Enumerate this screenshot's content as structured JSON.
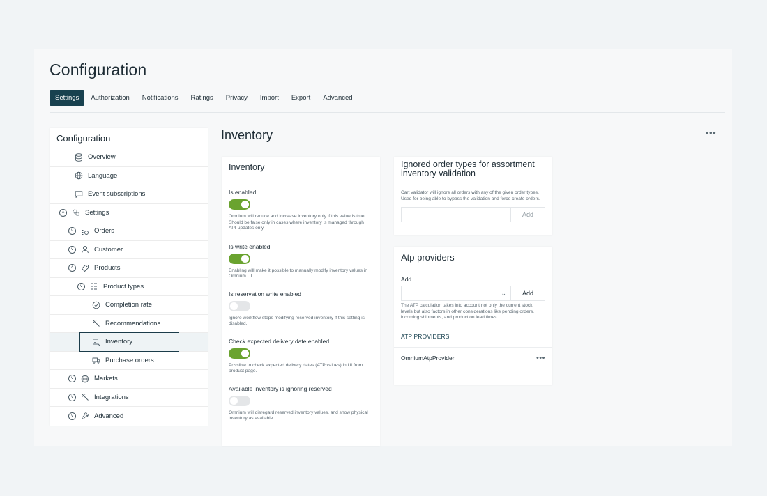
{
  "page": {
    "title": "Configuration"
  },
  "tabs": [
    "Settings",
    "Authorization",
    "Notifications",
    "Ratings",
    "Privacy",
    "Import",
    "Export",
    "Advanced"
  ],
  "sidebar": {
    "title": "Configuration",
    "items": [
      {
        "label": "Overview",
        "icon": "database-icon"
      },
      {
        "label": "Language",
        "icon": "globe-icon"
      },
      {
        "label": "Event subscriptions",
        "icon": "message-icon"
      },
      {
        "label": "Settings",
        "icon": "gears-icon",
        "chevron": "up"
      },
      {
        "label": "Orders",
        "icon": "orders-icon",
        "chevron": "down"
      },
      {
        "label": "Customer",
        "icon": "user-icon",
        "chevron": "down"
      },
      {
        "label": "Products",
        "icon": "tag-icon",
        "chevron": "up"
      },
      {
        "label": "Product types",
        "icon": "list-icon",
        "chevron": "down"
      },
      {
        "label": "Completion rate",
        "icon": "check-circle-icon"
      },
      {
        "label": "Recommendations",
        "icon": "wand-icon"
      },
      {
        "label": "Inventory",
        "icon": "inventory-icon",
        "selected": true
      },
      {
        "label": "Purchase orders",
        "icon": "truck-icon"
      },
      {
        "label": "Markets",
        "icon": "globe-icon",
        "chevron": "down"
      },
      {
        "label": "Integrations",
        "icon": "plug-icon",
        "chevron": "down"
      },
      {
        "label": "Advanced",
        "icon": "wrench-icon",
        "chevron": "down"
      }
    ]
  },
  "content": {
    "title": "Inventory",
    "more": "•••"
  },
  "inventory_card": {
    "title": "Inventory",
    "settings": [
      {
        "label": "Is enabled",
        "on": true,
        "help": "Omnium will reduce and increase inventory only if this value is true. Should be false only in cases where inventory is managed through API-updates only."
      },
      {
        "label": "Is write enabled",
        "on": true,
        "help": "Enabling will make it possible to manually modify inventory values in Omnium UI."
      },
      {
        "label": "Is reservation write enabled",
        "on": false,
        "help": "Ignore workflow steps modifying reserved inventory if this setting is disabled."
      },
      {
        "label": "Check expected delivery date enabled",
        "on": true,
        "help": "Possible to check expected delivery dates (ATP values) in UI from product page."
      },
      {
        "label": "Available inventory is ignoring reserved",
        "on": false,
        "help": "Omnium will disregard reserved inventory values, and show physical inventory as available."
      }
    ]
  },
  "ignored_card": {
    "title": "Ignored order types for assortment inventory validation",
    "help": "Cart validator will ignore all orders with any of the given order types. Used for being able to bypass the validation and force create orders.",
    "input_value": "",
    "add_label": "Add"
  },
  "atp_card": {
    "title": "Atp providers",
    "add_field_label": "Add",
    "add_button_label": "Add",
    "help": "The ATP calculation takes into account not only the current stock levels but also factors in other considerations like pending orders, incoming shipments, and production lead times.",
    "section_title": "ATP PROVIDERS",
    "providers": [
      {
        "name": "OmniumAtpProvider",
        "more": "•••"
      }
    ]
  },
  "colors": {
    "accent": "#18414f",
    "toggle_on": "#6aa32f",
    "toggle_off": "#e4e6e8"
  }
}
